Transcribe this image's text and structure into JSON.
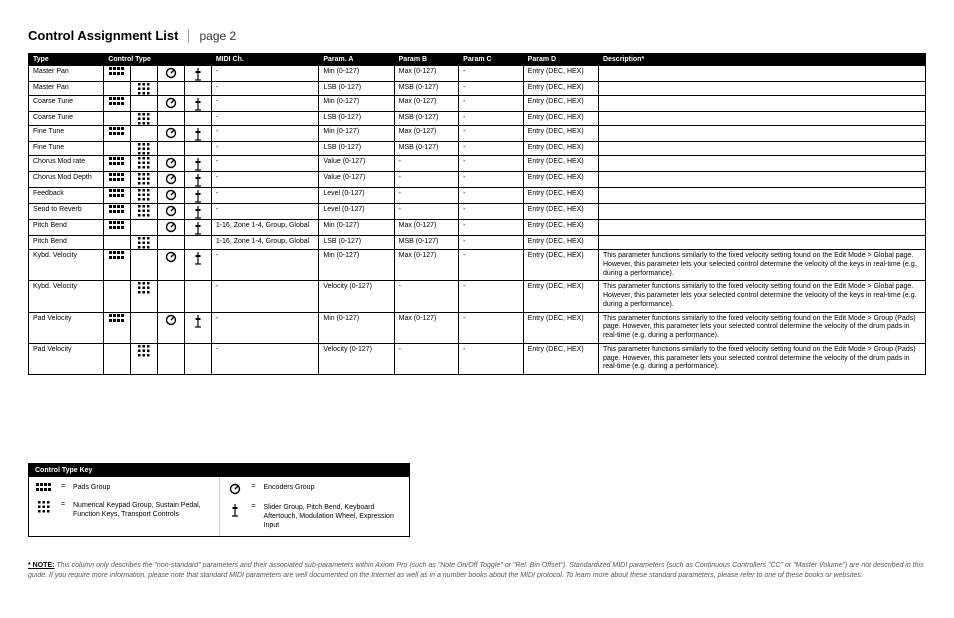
{
  "header": {
    "title": "Control Assignment List",
    "page": "page 2"
  },
  "columns": {
    "type": "Type",
    "ctrl": "Control  Type",
    "midi": "MIDI Ch.",
    "pa": "Param. A",
    "pb": "Param B",
    "pc": "Param C",
    "pd": "Param D",
    "desc": "Description*"
  },
  "rows": [
    {
      "type": "Master Pan",
      "ct": [
        "pads",
        "",
        "enc",
        "slider"
      ],
      "midi": "-",
      "pa": "Min (0-127)",
      "pb": "Max (0-127)",
      "pc": "-",
      "pd": "Entry (DEC, HEX)",
      "desc": ""
    },
    {
      "type": "Master Pan",
      "ct": [
        "",
        "numkey",
        "",
        ""
      ],
      "midi": "-",
      "pa": "LSB (0-127)",
      "pb": "MSB (0-127)",
      "pc": "-",
      "pd": "Entry (DEC, HEX)",
      "desc": ""
    },
    {
      "type": "Coarse Tune",
      "ct": [
        "pads",
        "",
        "enc",
        "slider"
      ],
      "midi": "-",
      "pa": "Min (0-127)",
      "pb": "Max (0-127)",
      "pc": "-",
      "pd": "Entry (DEC, HEX)",
      "desc": ""
    },
    {
      "type": "Coarse Tune",
      "ct": [
        "",
        "numkey",
        "",
        ""
      ],
      "midi": "-",
      "pa": "LSB (0-127)",
      "pb": "MSB (0-127)",
      "pc": "-",
      "pd": "Entry (DEC, HEX)",
      "desc": ""
    },
    {
      "type": "Fine Tune",
      "ct": [
        "pads",
        "",
        "enc",
        "slider"
      ],
      "midi": "-",
      "pa": "Min (0-127)",
      "pb": "Max (0-127)",
      "pc": "-",
      "pd": "Entry (DEC, HEX)",
      "desc": ""
    },
    {
      "type": "Fine Tune",
      "ct": [
        "",
        "numkey",
        "",
        ""
      ],
      "midi": "-",
      "pa": "LSB (0-127)",
      "pb": "MSB (0-127)",
      "pc": "-",
      "pd": "Entry (DEC, HEX)",
      "desc": ""
    },
    {
      "type": "Chorus Mod rate",
      "ct": [
        "pads",
        "numkey",
        "enc",
        "slider"
      ],
      "midi": "-",
      "pa": "Value (0-127)",
      "pb": "-",
      "pc": "-",
      "pd": "Entry (DEC, HEX)",
      "desc": ""
    },
    {
      "type": "Chorus Mod Depth",
      "ct": [
        "pads",
        "numkey",
        "enc",
        "slider"
      ],
      "midi": "-",
      "pa": "Value (0-127)",
      "pb": "-",
      "pc": "-",
      "pd": "Entry (DEC, HEX)",
      "desc": ""
    },
    {
      "type": "Feedback",
      "ct": [
        "pads",
        "numkey",
        "enc",
        "slider"
      ],
      "midi": "-",
      "pa": "Level (0-127)",
      "pb": "-",
      "pc": "-",
      "pd": "Entry (DEC, HEX)",
      "desc": ""
    },
    {
      "type": "Send to Reverb",
      "ct": [
        "pads",
        "numkey",
        "enc",
        "slider"
      ],
      "midi": "-",
      "pa": "Level (0-127)",
      "pb": "-",
      "pc": "-",
      "pd": "Entry (DEC, HEX)",
      "desc": ""
    },
    {
      "type": "Pitch Bend",
      "ct": [
        "pads",
        "",
        "enc",
        "slider"
      ],
      "midi": "1-16, Zone 1-4, Group, Global",
      "pa": "Min (0-127)",
      "pb": "Max (0-127)",
      "pc": "-",
      "pd": "Entry (DEC, HEX)",
      "desc": ""
    },
    {
      "type": "Pitch Bend",
      "ct": [
        "",
        "numkey",
        "",
        ""
      ],
      "midi": "1-16, Zone 1-4, Group, Global",
      "pa": "LSB (0-127)",
      "pb": "MSB (0-127)",
      "pc": "-",
      "pd": "Entry (DEC, HEX)",
      "desc": ""
    },
    {
      "type": "Kybd. Velocity",
      "ct": [
        "pads",
        "",
        "enc",
        "slider"
      ],
      "midi": "-",
      "pa": "Min (0-127)",
      "pb": "Max (0-127)",
      "pc": "-",
      "pd": "Entry (DEC, HEX)",
      "desc": "This parameter functions similarly to the fixed velocity setting found on the Edit Mode > Global page. However, this parameter lets your selected control determine the velocity of the keys in real-time (e.g. during a performance)."
    },
    {
      "type": "Kybd. Velocity",
      "ct": [
        "",
        "numkey",
        "",
        ""
      ],
      "midi": "-",
      "pa": "Velocity (0-127)",
      "pb": "-",
      "pc": "-",
      "pd": "Entry (DEC, HEX)",
      "desc": "This parameter functions similarly to the fixed velocity setting found on the Edit Mode > Global page. However, this parameter lets your selected control determine the velocity of the keys in real-time (e.g. during a performance)."
    },
    {
      "type": "Pad Velocity",
      "ct": [
        "pads",
        "",
        "enc",
        "slider"
      ],
      "midi": "-",
      "pa": "Min (0-127)",
      "pb": "Max (0-127)",
      "pc": "-",
      "pd": "Entry (DEC, HEX)",
      "desc": "This parameter functions similarly to the fixed velocity setting found on the Edit Mode > Group (Pads) page. However, this parameter lets your selected control determine the velocity of the drum pads in real-time (e.g. during a performance)."
    },
    {
      "type": "Pad Velocity",
      "ct": [
        "",
        "numkey",
        "",
        ""
      ],
      "midi": "-",
      "pa": "Velocity (0-127)",
      "pb": "-",
      "pc": "-",
      "pd": "Entry (DEC, HEX)",
      "desc": "This parameter functions similarly to the fixed velocity setting found on the Edit Mode > Group (Pads) page. However, this parameter lets your selected control determine the velocity of the drum pads in real-time (e.g. during a performance)."
    }
  ],
  "key": {
    "header": "Control Type Key",
    "eq": "=",
    "pads": "Pads Group",
    "numkey": "Numerical Keypad Group, Sustain Pedal, Function Keys, Transport Controls",
    "enc": "Encoders Group",
    "slider": "Slider Group, Pitch Bend, Keyboard Aftertouch, Modulation Wheel, Expression Input"
  },
  "note": {
    "lead": "* NOTE:",
    "body": "This column only describes the \"non-standard\" parameters and their associated sub-parameters within Axiom Pro (such as \"Note On/Off Toggle\" or \"Rel. Bin Offset\").  Standardized MIDI parameters (such as Continuous Controllers \"CC\" or \"Master Volume\") are not described in this guide.  If you require more information, please note that standard MIDI parameters are well documented on the Internet as well as in a number books about the MIDI protocol.  To learn more about these standard parameters, please refer to one of these books or websites."
  }
}
